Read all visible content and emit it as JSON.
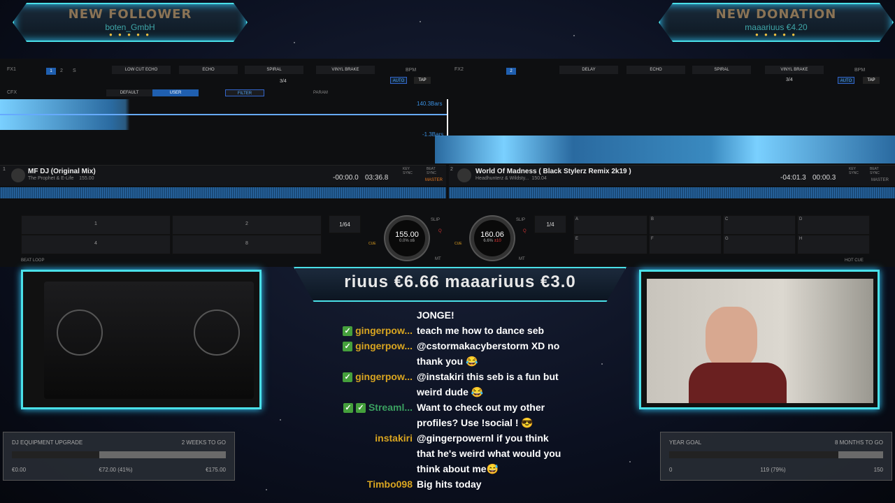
{
  "alerts": {
    "follower": {
      "title": "NEW FOLLOWER",
      "name": "boten_GmbH"
    },
    "donation": {
      "title": "NEW DONATION",
      "name": "maaariuus €4.20"
    },
    "dots": "● ● ● ● ●"
  },
  "fx": {
    "fx1": "FX1",
    "fx2": "FX2",
    "cfx": "CFX",
    "fx1_effects": [
      "LOW CUT ECHO",
      "ECHO",
      "SPIRAL",
      "VINYL BRAKE"
    ],
    "fx2_effects": [
      "DELAY",
      "ECHO",
      "SPIRAL",
      "VINYL BRAKE"
    ],
    "beat_val": "3/4",
    "bpm": "BPM",
    "auto": "AUTO",
    "tap": "TAP",
    "cfx_tabs": [
      "DEFAULT",
      "USER",
      "FILTER"
    ],
    "param": "PARAM",
    "slot_nums": [
      "1",
      "2",
      "S",
      "3",
      "4",
      "M"
    ]
  },
  "waveform": {
    "deck1_bars": "140.3Bars",
    "deck2_bars": "-1.3Bars"
  },
  "deck1": {
    "num": "1",
    "title": "MF DJ (Original Mix)",
    "artist": "The Prophet & E-Life",
    "bpm": "155.00",
    "remain": "-00:00.0",
    "total": "03:36.8",
    "key_sync": "KEY SYNC",
    "beat_sync": "BEAT SYNC",
    "master": "MASTER",
    "loop": "1/64",
    "jog_bpm": "155.00",
    "jog_pct": "0.0%",
    "jog_range": "±6",
    "cue": "CUE",
    "slip": "SLIP",
    "q": "Q",
    "mt": "MT",
    "beat_loop": "BEAT LOOP"
  },
  "deck2": {
    "num": "2",
    "title": "World Of Madness ( Black Stylerz Remix 2k19 )",
    "artist": "Headhunterz & Wildsty...",
    "bpm": "150.04",
    "remain": "-04:01.3",
    "total": "00:00.3",
    "key_sync": "KEY SYNC",
    "beat_sync": "BEAT SYNC",
    "master": "MASTER",
    "loop": "1/4",
    "jog_bpm": "160.06",
    "jog_pct": "6.6%",
    "jog_range": "±10",
    "cue": "CUE",
    "slip": "SLIP",
    "q": "Q",
    "mt": "MT",
    "hot_cue": "HOT CUE"
  },
  "pads1": [
    "1",
    "2",
    "4",
    "8"
  ],
  "pads2": [
    "A",
    "B",
    "C",
    "D",
    "E",
    "F",
    "G",
    "H"
  ],
  "ticker": "riuus €6.66    maaariuus €3.0",
  "goal_left": {
    "label": "DJ EQUIPMENT UPGRADE",
    "time": "2 WEEKS TO GO",
    "min": "€0.00",
    "current": "€72.00 (41%)",
    "max": "€175.00",
    "progress": 0.41
  },
  "goal_right": {
    "label": "YEAR GOAL",
    "time": "8 MONTHS TO GO",
    "min": "0",
    "current": "119 (79%)",
    "max": "150",
    "progress": 0.79
  },
  "chat": [
    {
      "user": "",
      "color": "#fff",
      "msg": "JONGE!",
      "badges": 0
    },
    {
      "user": "gingerpow...",
      "color": "#d9a520",
      "msg": "teach me how to dance seb",
      "badges": 1
    },
    {
      "user": "gingerpow...",
      "color": "#d9a520",
      "msg": "@cstormakacyberstorm XD no thank you 😂",
      "badges": 1
    },
    {
      "user": "gingerpow...",
      "color": "#d9a520",
      "msg": "@instakiri this seb is a fun but weird dude 😂",
      "badges": 1
    },
    {
      "user": "Streaml...",
      "color": "#3aa060",
      "msg": "Want to check out my other profiles? Use !social ! 😎",
      "badges": 2
    },
    {
      "user": "instakiri",
      "color": "#d9a520",
      "msg": "@gingerpowernl if you think that he's weird what would you think about me😅",
      "badges": 0
    },
    {
      "user": "Timbo098",
      "color": "#d9a520",
      "msg": "Big hits today",
      "badges": 0
    }
  ]
}
